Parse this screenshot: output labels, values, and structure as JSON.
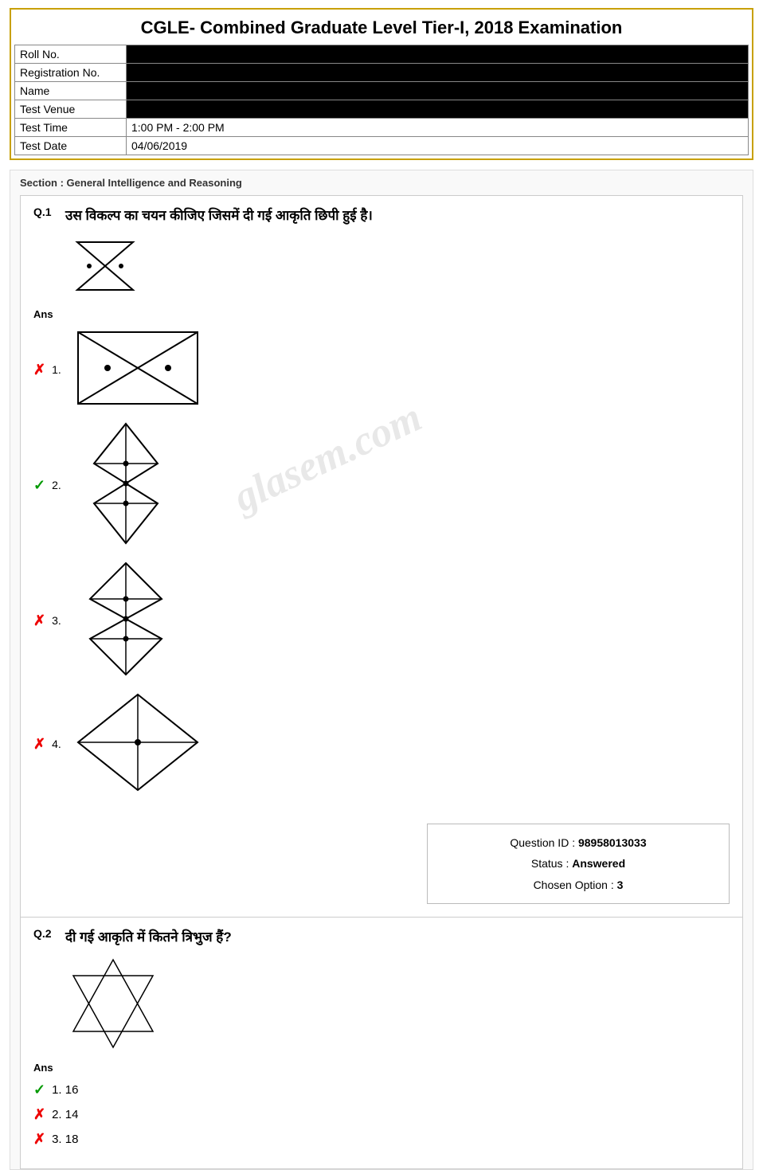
{
  "header": {
    "title": "CGLE- Combined Graduate Level Tier-I, 2018 Examination",
    "fields": [
      {
        "label": "Roll No.",
        "value": "",
        "redacted": true
      },
      {
        "label": "Registration No.",
        "value": "",
        "redacted": true
      },
      {
        "label": "Name",
        "value": "",
        "redacted": true
      },
      {
        "label": "Test Venue",
        "value": "",
        "redacted": true
      },
      {
        "label": "Test Time",
        "value": "1:00 PM - 2:00 PM",
        "redacted": false
      },
      {
        "label": "Test Date",
        "value": "04/06/2019",
        "redacted": false
      }
    ]
  },
  "section": {
    "prefix": "Section :",
    "name": "General Intelligence and Reasoning"
  },
  "q1": {
    "number": "Q.1",
    "text": "उस विकल्प का चयन कीजिए जिसमें दी गई आकृति छिपी हुई है।",
    "ans_label": "Ans",
    "options": [
      {
        "num": "1.",
        "correct": false
      },
      {
        "num": "2.",
        "correct": true
      },
      {
        "num": "3.",
        "correct": false
      },
      {
        "num": "4.",
        "correct": false
      }
    ],
    "info": {
      "question_id_label": "Question ID :",
      "question_id": "98958013033",
      "status_label": "Status :",
      "status": "Answered",
      "chosen_label": "Chosen Option :",
      "chosen": "3"
    }
  },
  "q2": {
    "number": "Q.2",
    "text": "दी गई आकृति में कितने त्रिभुज हैं?",
    "ans_label": "Ans",
    "options": [
      {
        "num": "1.",
        "value": "16",
        "correct": true
      },
      {
        "num": "2.",
        "value": "14",
        "correct": false
      },
      {
        "num": "3.",
        "value": "18",
        "correct": false
      }
    ]
  },
  "watermark": {
    "text": "glasem.com"
  }
}
